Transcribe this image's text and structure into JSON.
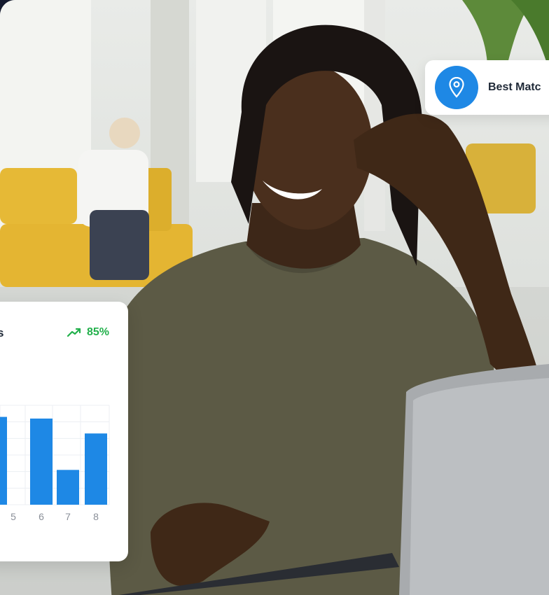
{
  "best_match": {
    "label": "Best Matc",
    "icon": "location-pin-icon",
    "accent_color": "#1e88e5"
  },
  "stats_card": {
    "title_fragment": "s",
    "trend_icon": "trend-up-icon",
    "trend_value": "85%",
    "trend_color": "#22b04b",
    "bar_color": "#1e88e5"
  },
  "chart_data": {
    "type": "bar",
    "categories": [
      "5",
      "6",
      "7",
      "8"
    ],
    "values": [
      5.3,
      5.2,
      2.1,
      4.3
    ],
    "partial_bar_before_first_category": 5.3,
    "ylim": [
      0,
      6
    ],
    "grid": true,
    "title": "",
    "xlabel": "",
    "ylabel": ""
  }
}
